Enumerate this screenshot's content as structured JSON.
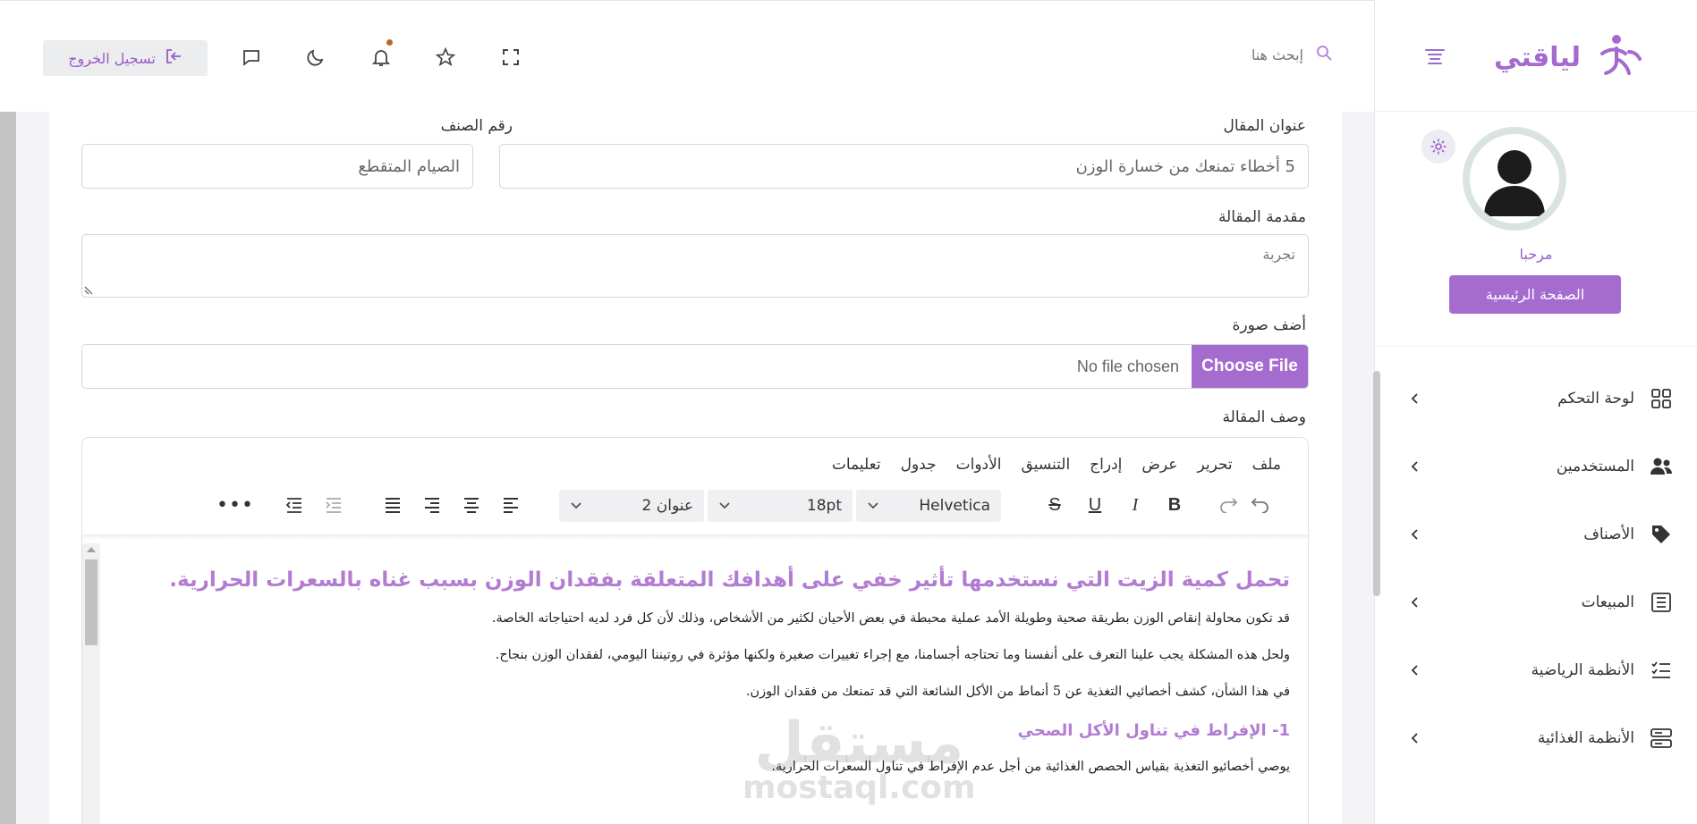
{
  "brand": {
    "logo_text": "لياقتي"
  },
  "header": {
    "search_placeholder": "إبحث هنا",
    "logout_label": "تسجيل الخروج"
  },
  "profile": {
    "welcome": "مرحبا",
    "home_button": "الصفحة الرئيسية"
  },
  "sidebar": {
    "items": [
      {
        "label": "لوحة التحكم",
        "icon": "grid-icon"
      },
      {
        "label": "المستخدمين",
        "icon": "users-icon"
      },
      {
        "label": "الأصناف",
        "icon": "tag-icon"
      },
      {
        "label": "المبيعات",
        "icon": "receipt-icon"
      },
      {
        "label": "الأنظمة الرياضية",
        "icon": "checklist-icon"
      },
      {
        "label": "الأنظمة الغذائية",
        "icon": "server-icon"
      }
    ]
  },
  "form": {
    "article_title_label": "عنوان المقال",
    "article_title_value": "5 أخطاء تمنعك من خسارة الوزن",
    "category_label": "رقم الصنف",
    "category_value": "الصيام المتقطع",
    "intro_label": "مقدمة المقالة",
    "intro_value": "تجربة",
    "image_label": "أضف صورة",
    "choose_file": "Choose File",
    "no_file": "No file chosen",
    "description_label": "وصف المقالة"
  },
  "editor": {
    "menu": [
      "ملف",
      "تحرير",
      "عرض",
      "إدراج",
      "التنسيق",
      "الأدوات",
      "جدول",
      "تعليمات"
    ],
    "font_family": "Helvetica",
    "font_size": "18pt",
    "block_format": "عنوان 2",
    "content": {
      "heading": "تحمل كمية الزيت التي نستخدمها تأثير خفي على أهدافك المتعلقة بفقدان الوزن بسبب غناه بالسعرات الحرارية.",
      "p1": "قد تكون محاولة إنقاص الوزن بطريقة صحية وطويلة الأمد عملية محبطة في بعض الأحيان لكثير من الأشخاص، وذلك لأن كل فرد لديه احتياجاته الخاصة.",
      "p2": "ولحل هذه المشكلة يجب علينا التعرف على أنفسنا وما تحتاجه أجسامنا، مع إجراء تغييرات صغيرة ولكنها مؤثرة في روتيننا اليومي، لفقدان الوزن بنجاح.",
      "p3": "في هذا الشأن، كشف أخصائيي التغذية عن 5 أنماط من الأكل الشائعة التي قد تمنعك من فقدان الوزن.",
      "sub1": "1- الإفراط في تناول الأكل الصحي",
      "p4": "يوصي أخصائيو التغذية بقياس الحصص الغذائية من أجل عدم الإفراط في تناول السعرات الحرارية."
    }
  },
  "watermark": {
    "line1": "مستقل",
    "line2": "mostaql.com"
  },
  "colors": {
    "accent": "#a56cd0",
    "accent_text": "#b27cd2"
  }
}
